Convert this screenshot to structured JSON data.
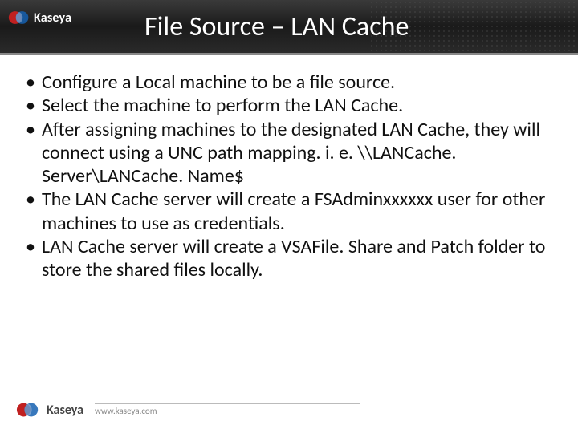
{
  "brand": {
    "name": "Kaseya",
    "url": "www.kaseya.com"
  },
  "title": "File Source – LAN Cache",
  "bullets": [
    "Configure a Local machine to be a file source.",
    "Select the machine to perform the LAN Cache.",
    "After assigning machines to the designated LAN Cache, they will connect using a UNC path mapping.  i. e. \\\\LANCache. Server\\LANCache. Name$",
    "The LAN Cache server will create a FSAdminxxxxxx user for other machines to use as credentials.",
    "LAN Cache server will create a VSAFile. Share and Patch folder to store the shared files locally."
  ]
}
